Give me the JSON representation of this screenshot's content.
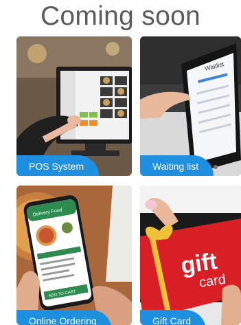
{
  "heading": "Coming soon",
  "cards": [
    {
      "label": "POS System",
      "icon": "pos-terminal-photo"
    },
    {
      "label": "Waiting list",
      "icon": "waitlist-tablet-photo"
    },
    {
      "label": "Online Ordering",
      "icon": "mobile-order-photo"
    },
    {
      "label": "Gift Card",
      "icon": "gift-card-photo"
    }
  ],
  "waitlist_screen": {
    "title": "Waitlist"
  },
  "phone_screen": {
    "title": "Delivery Food",
    "cart_label": "ADD TO CART"
  },
  "gift_card_text": {
    "line1": "gift",
    "line2": "card"
  },
  "colors": {
    "accent": "#1f8fe0",
    "heading": "#5b5b5b"
  }
}
